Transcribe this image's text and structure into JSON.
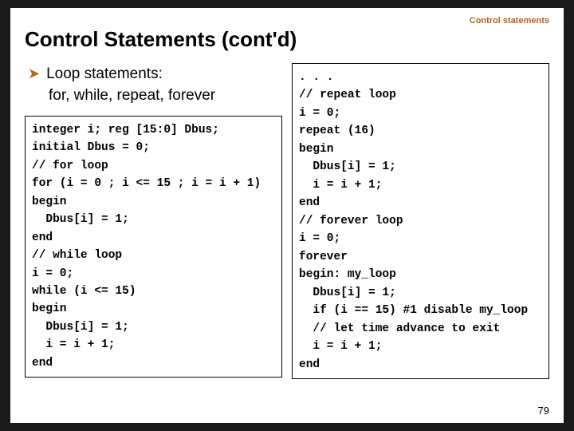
{
  "header": {
    "topic": "Control statements",
    "title": "Control Statements (cont'd)"
  },
  "bullet": {
    "heading": "Loop statements:",
    "subline": "for, while, repeat, forever"
  },
  "code_left": "integer i; reg [15:0] Dbus;\ninitial Dbus = 0;\n// for loop\nfor (i = 0 ; i <= 15 ; i = i + 1)\nbegin\n  Dbus[i] = 1;\nend\n// while loop\ni = 0;\nwhile (i <= 15)\nbegin\n  Dbus[i] = 1;\n  i = i + 1;\nend",
  "code_right": ". . .\n// repeat loop\ni = 0;\nrepeat (16)\nbegin\n  Dbus[i] = 1;\n  i = i + 1;\nend\n// forever loop\ni = 0;\nforever\nbegin: my_loop\n  Dbus[i] = 1;\n  if (i == 15) #1 disable my_loop\n  // let time advance to exit\n  i = i + 1;\nend",
  "page_number": "79"
}
